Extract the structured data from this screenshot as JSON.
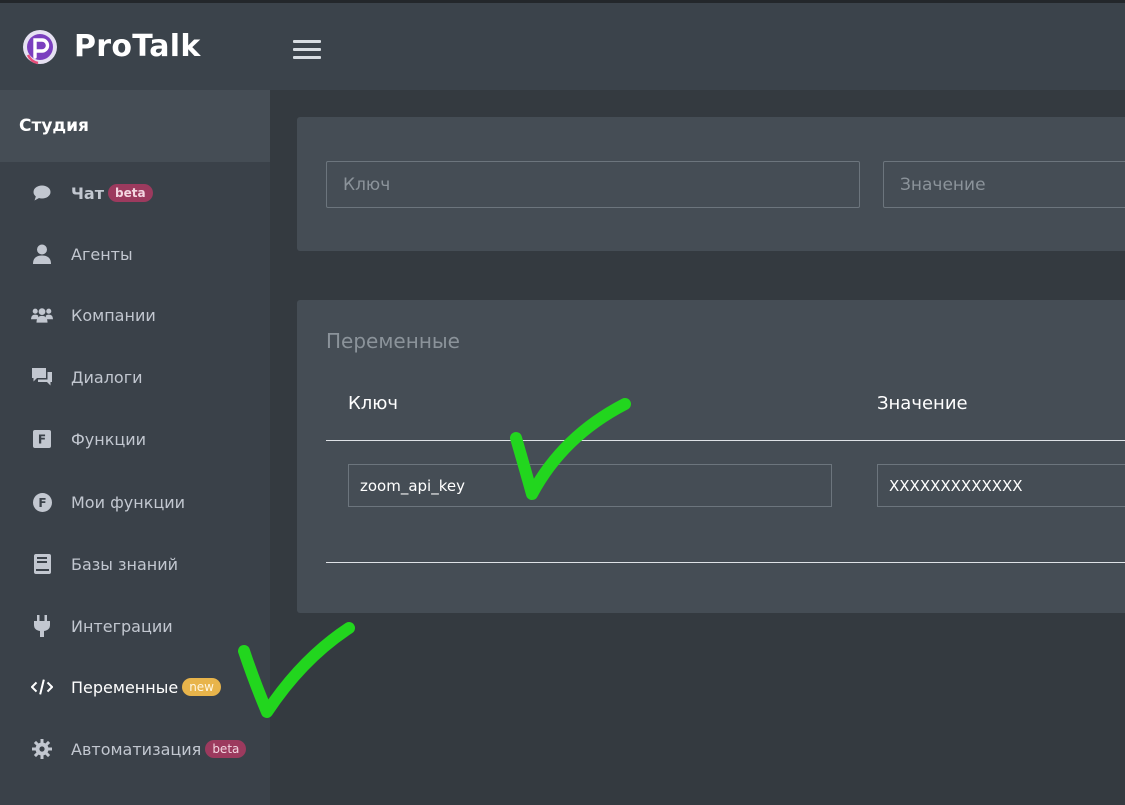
{
  "app": {
    "brand": "ProTalk"
  },
  "colors": {
    "sidebar_bg": "#3a4149",
    "main_bg": "#343a40",
    "card_bg": "#454d55",
    "badge_beta": "#9c3a5e",
    "badge_new": "#e8b44b",
    "annotation_check": "#22d61e"
  },
  "sidebar": {
    "section": "Студия",
    "items": [
      {
        "label": "Чат",
        "icon": "chat-bubble-icon",
        "badge": "beta"
      },
      {
        "label": "Агенты",
        "icon": "user-icon"
      },
      {
        "label": "Компании",
        "icon": "users-group-icon"
      },
      {
        "label": "Диалоги",
        "icon": "comments-icon"
      },
      {
        "label": "Функции",
        "icon": "function-square-icon"
      },
      {
        "label": "Мои функции",
        "icon": "function-circle-icon"
      },
      {
        "label": "Базы знаний",
        "icon": "book-icon"
      },
      {
        "label": "Интеграции",
        "icon": "plug-icon"
      },
      {
        "label": "Переменные",
        "icon": "code-icon",
        "badge": "new",
        "active": true
      },
      {
        "label": "Автоматизация",
        "icon": "gear-icon",
        "badge": "beta"
      }
    ]
  },
  "form": {
    "key_placeholder": "Ключ",
    "value_placeholder": "Значение"
  },
  "variables": {
    "title": "Переменные",
    "col_key": "Ключ",
    "col_value": "Значение",
    "rows": [
      {
        "key": "zoom_api_key",
        "value": "XXXXXXXXXXXXX"
      }
    ]
  }
}
